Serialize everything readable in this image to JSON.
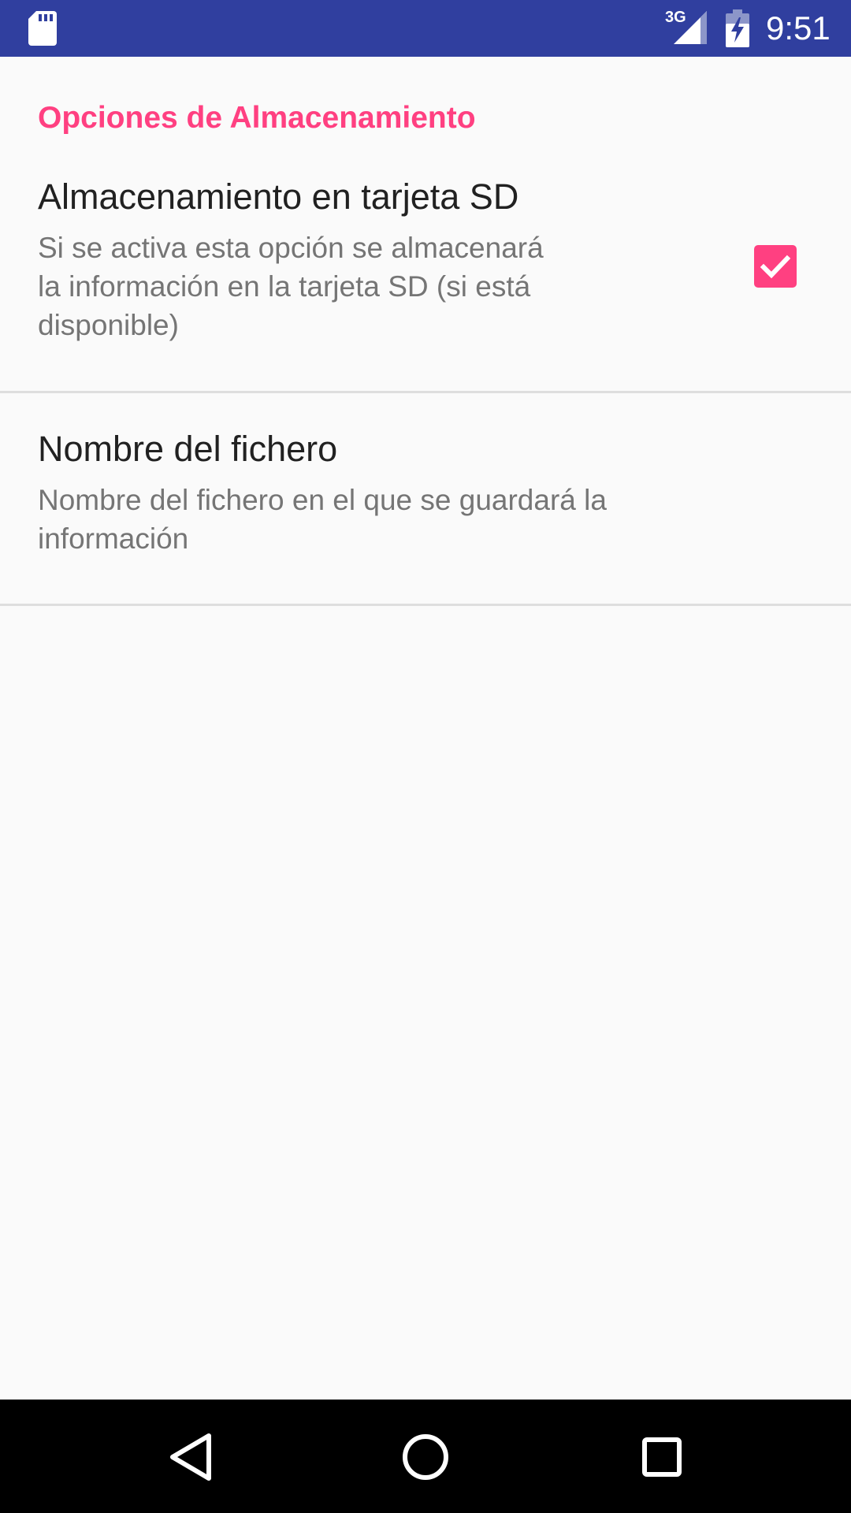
{
  "status_bar": {
    "time": "9:51",
    "network_type": "3G",
    "icons": [
      "sd-card-icon",
      "signal-icon",
      "battery-charging-icon"
    ],
    "background_color": "#303f9f"
  },
  "settings": {
    "category_title": "Opciones de Almacenamiento",
    "accent_color": "#ff4081",
    "items": [
      {
        "title": "Almacenamiento en tarjeta SD",
        "summary_lines": [
          "Si se activa esta opción se almacenará",
          "la información en la tarjeta SD (si está",
          "disponible)"
        ],
        "checked": true
      },
      {
        "title": "Nombre del fichero",
        "summary_lines": [
          "Nombre del fichero en el que se guardará la",
          "información"
        ]
      }
    ]
  },
  "nav_bar": {
    "icons": [
      "back-icon",
      "home-icon",
      "recents-icon"
    ]
  }
}
